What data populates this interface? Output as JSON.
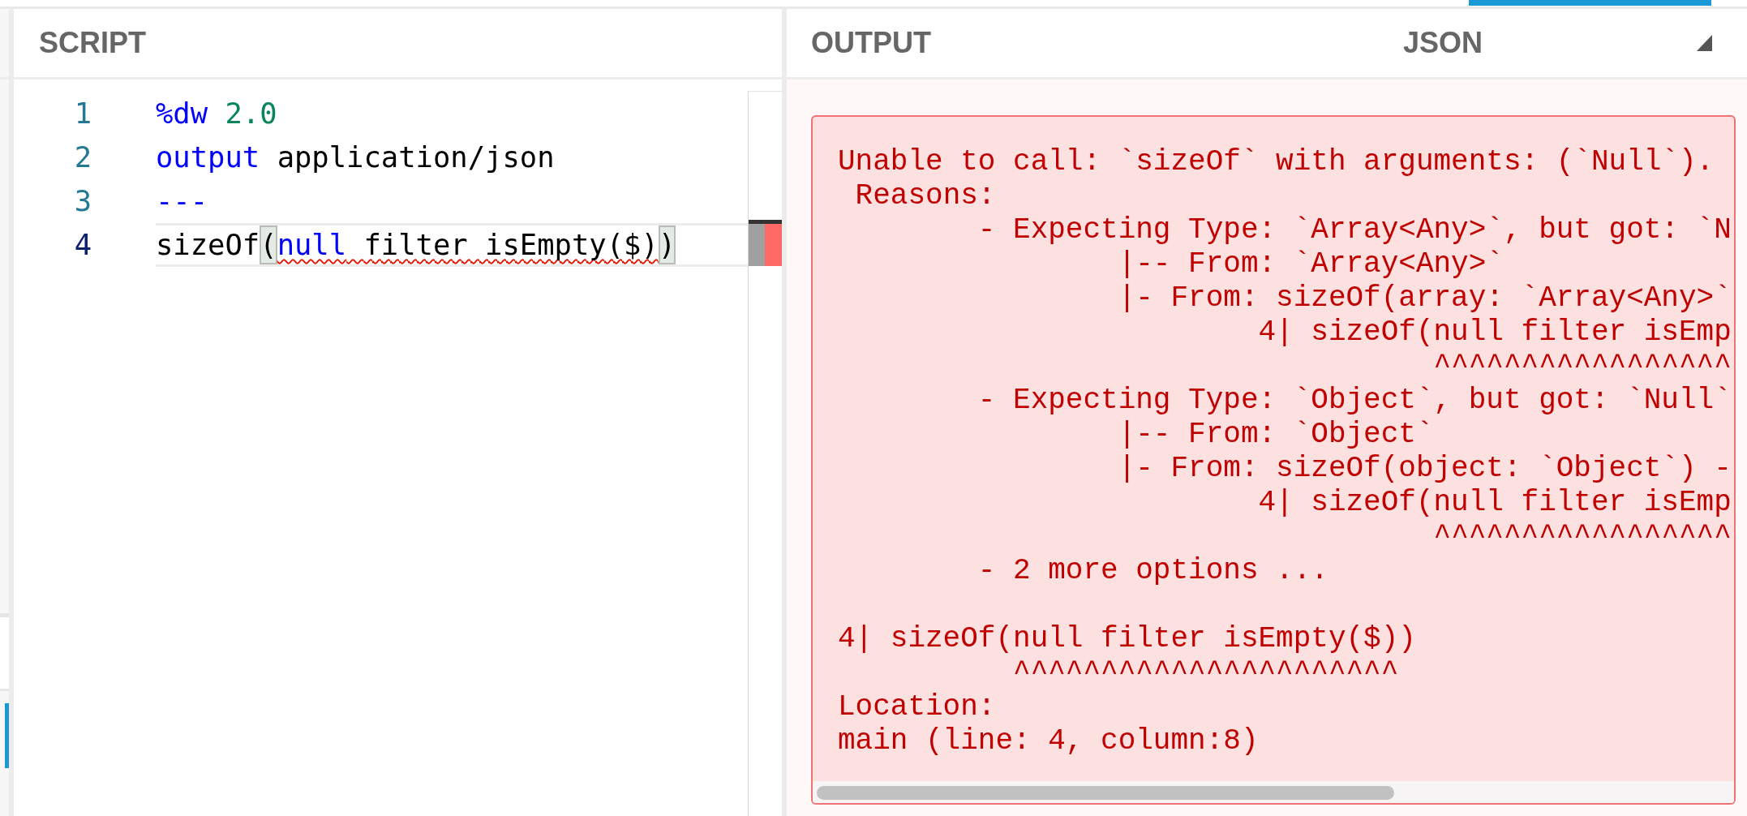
{
  "script": {
    "title": "SCRIPT",
    "lines": [
      {
        "number": "1",
        "current": false,
        "tokens": [
          {
            "text": "%dw",
            "kind": "keyword",
            "error": false,
            "highlighted": false
          },
          {
            "text": " 2.0",
            "kind": "number",
            "error": false,
            "highlighted": false
          }
        ]
      },
      {
        "number": "2",
        "current": false,
        "tokens": [
          {
            "text": "output",
            "kind": "keyword",
            "error": false,
            "highlighted": false
          },
          {
            "text": " application/json",
            "kind": "plain",
            "error": false,
            "highlighted": false
          }
        ]
      },
      {
        "number": "3",
        "current": false,
        "tokens": [
          {
            "text": "---",
            "kind": "keyword",
            "error": false,
            "highlighted": false
          }
        ]
      },
      {
        "number": "4",
        "current": true,
        "tokens": [
          {
            "text": "sizeOf",
            "kind": "plain",
            "error": false,
            "highlighted": false
          },
          {
            "text": "(",
            "kind": "plain",
            "error": false,
            "highlighted": true
          },
          {
            "text": "null",
            "kind": "keyword",
            "error": true,
            "highlighted": false
          },
          {
            "text": " filter isEmpty($)",
            "kind": "plain",
            "error": true,
            "highlighted": false
          },
          {
            "text": ")",
            "kind": "plain",
            "error": false,
            "highlighted": true
          }
        ]
      }
    ]
  },
  "output": {
    "title": "OUTPUT",
    "format": "JSON",
    "error_blocks": [
      {
        "lines": [
          "Unable to call: `sizeOf` with arguments: (`Null`).",
          " Reasons:",
          "        - Expecting Type: `Array<Any>`, but got: `N",
          "                |-- From: `Array<Any>`",
          "                |- From: sizeOf(array: `Array<Any>`",
          "                        4| sizeOf(null filter isEmp",
          "                                  ^^^^^^^^^^^^^^^^^",
          "        - Expecting Type: `Object`, but got: `Null`",
          "                |-- From: `Object`",
          "                |- From: sizeOf(object: `Object`) -",
          "                        4| sizeOf(null filter isEmp",
          "                                  ^^^^^^^^^^^^^^^^^",
          "        - 2 more options ..."
        ]
      },
      {
        "lines": [
          "4| sizeOf(null filter isEmpty($))",
          "          ^^^^^^^^^^^^^^^^^^^^^^",
          "Location:",
          "main (line: 4, column:8)"
        ]
      }
    ]
  }
}
